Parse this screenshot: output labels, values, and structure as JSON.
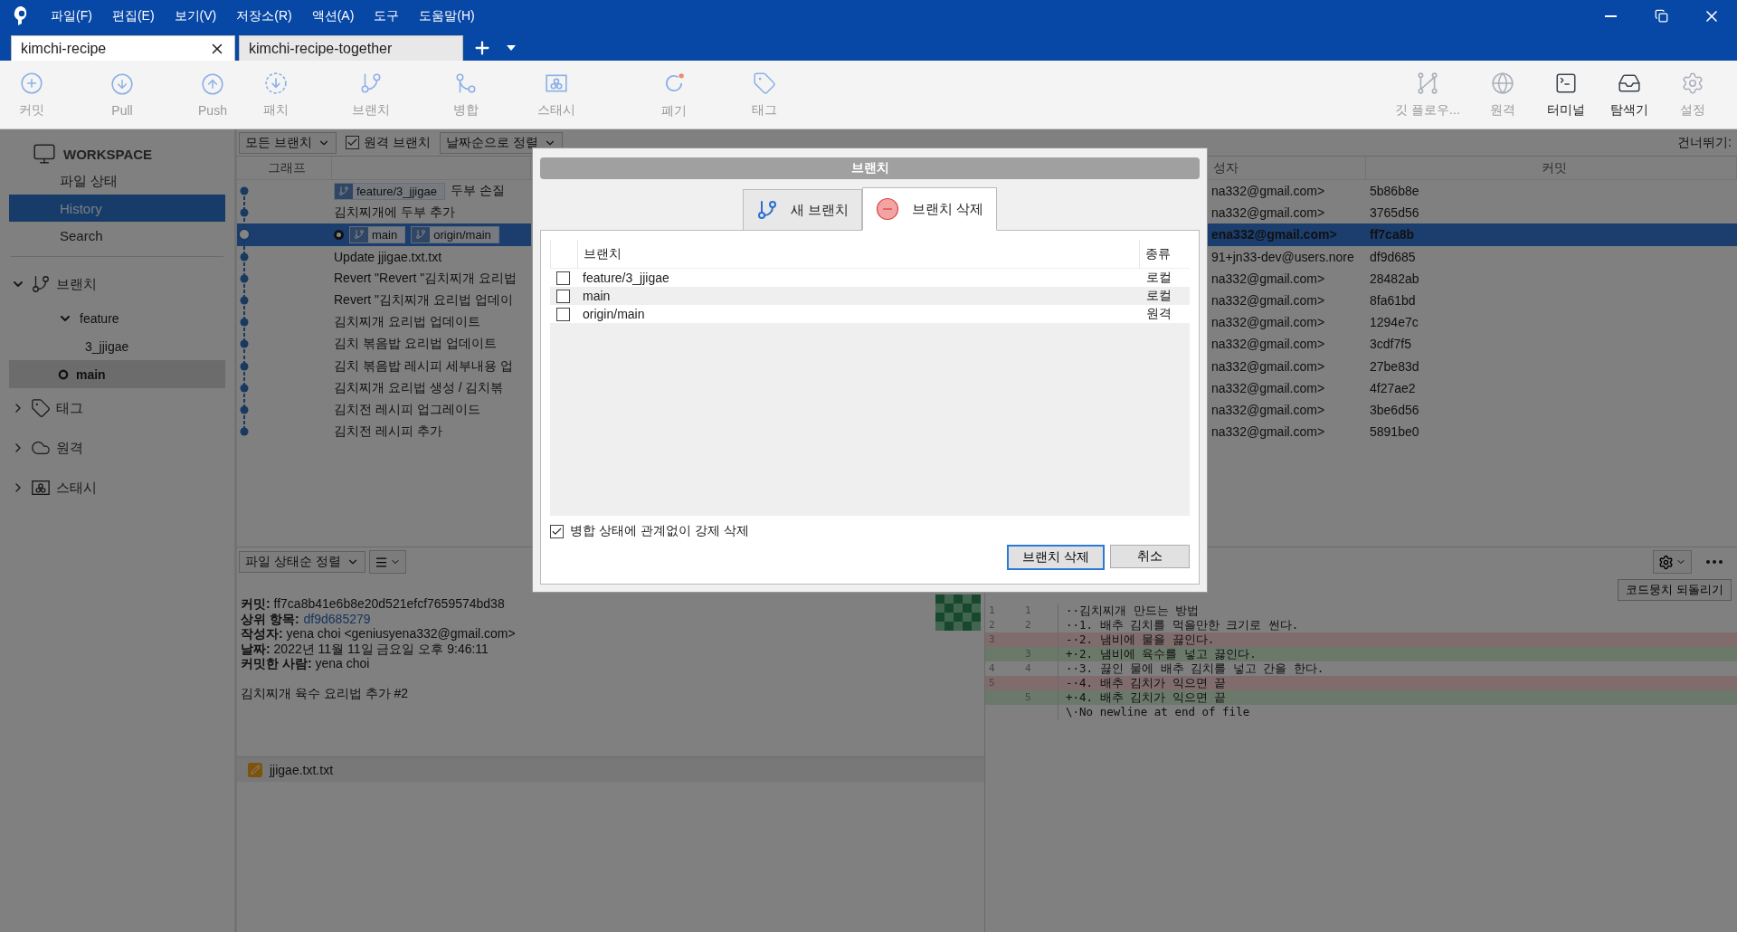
{
  "menu": [
    "파일(F)",
    "편집(E)",
    "보기(V)",
    "저장소(R)",
    "액션(A)",
    "도구",
    "도움말(H)"
  ],
  "repo_tabs": [
    {
      "label": "kimchi-recipe",
      "selected": true
    },
    {
      "label": "kimchi-recipe-together",
      "selected": false
    }
  ],
  "toolbar": {
    "left": [
      {
        "label": "커밋",
        "disabled": true
      },
      {
        "label": "Pull",
        "disabled": true
      },
      {
        "label": "Push",
        "disabled": true
      },
      {
        "label": "패치",
        "disabled": true
      },
      {
        "label": "브랜치",
        "disabled": true
      },
      {
        "label": "병합",
        "disabled": true
      },
      {
        "label": "스태시",
        "disabled": true
      },
      {
        "label": "폐기",
        "disabled": true
      },
      {
        "label": "태그",
        "disabled": true
      }
    ],
    "right": [
      {
        "label": "깃 플로우...",
        "disabled": true
      },
      {
        "label": "원격",
        "disabled": true
      },
      {
        "label": "터미널",
        "disabled": false
      },
      {
        "label": "탐색기",
        "disabled": false
      },
      {
        "label": "설정",
        "disabled": true
      }
    ]
  },
  "sidebar": {
    "workspace": {
      "title": "WORKSPACE",
      "items": [
        {
          "label": "파일 상태",
          "selected": false
        },
        {
          "label": "History",
          "selected": true
        },
        {
          "label": "Search",
          "selected": false
        }
      ]
    },
    "sections": [
      {
        "label": "브랜치",
        "expanded": true,
        "children": [
          {
            "label": "feature",
            "expanded": true,
            "children": [
              {
                "label": "3_jjigae",
                "current": false,
                "selected": false
              }
            ]
          },
          {
            "label": "main",
            "current": true,
            "selected": true
          }
        ]
      },
      {
        "label": "태그",
        "expanded": false
      },
      {
        "label": "원격",
        "expanded": false
      },
      {
        "label": "스태시",
        "expanded": false
      }
    ]
  },
  "filter_bar": {
    "branch_filter": "모든 브랜치",
    "remote_branches": {
      "label": "원격 브랜치",
      "checked": true
    },
    "sort": "날짜순으로 정렬",
    "jump_label": "건너뛰기:"
  },
  "commits": {
    "columns": [
      "그래프",
      "성자",
      "커밋"
    ],
    "rows": [
      {
        "refs": [
          "feature/3_jjigae"
        ],
        "description": "두부 손질",
        "author": "na332@gmail.com>",
        "commit": "5b86b8e",
        "selected": false,
        "head": false
      },
      {
        "description": "김치찌개에 두부 추가",
        "author": "na332@gmail.com>",
        "commit": "3765d56",
        "selected": false,
        "head": false
      },
      {
        "refs": [
          "main",
          "origin/main"
        ],
        "author": "ena332@gmail.com>",
        "commit": "ff7ca8b",
        "selected": true,
        "head": true
      },
      {
        "description": "Update jjigae.txt.txt",
        "author": "91+jn33-dev@users.nore",
        "commit": "df9d685",
        "selected": false,
        "head": false
      },
      {
        "description": "Revert \"Revert \"김치찌개 요리법",
        "author": "na332@gmail.com>",
        "commit": "28482ab",
        "selected": false,
        "head": false
      },
      {
        "description": "Revert \"김치찌개 요리법 업데이",
        "author": "na332@gmail.com>",
        "commit": "8fa61bd",
        "selected": false,
        "head": false
      },
      {
        "description": "김치찌개 요리법 업데이트",
        "author": "na332@gmail.com>",
        "commit": "1294e7c",
        "selected": false,
        "head": false
      },
      {
        "description": "김치 볶음밥 요리법 업데이트",
        "author": "na332@gmail.com>",
        "commit": "3cdf7f5",
        "selected": false,
        "head": false
      },
      {
        "description": "김치 볶음밥 레시피 세부내용 업",
        "author": "na332@gmail.com>",
        "commit": "27be83d",
        "selected": false,
        "head": false
      },
      {
        "description": "김치찌개 요리법 생성 / 김치볶",
        "author": "na332@gmail.com>",
        "commit": "4f27ae2",
        "selected": false,
        "head": false
      },
      {
        "description": "김치전 레시피 업그레이드",
        "author": "na332@gmail.com>",
        "commit": "3be6d56",
        "selected": false,
        "head": false
      },
      {
        "description": "김치전 레시피 추가",
        "author": "na332@gmail.com>",
        "commit": "5891be0",
        "selected": false,
        "head": false
      }
    ]
  },
  "details": {
    "sort": "파일 상태순 정렬",
    "lines": [
      {
        "kind": "text",
        "text": "**커밋:** ff7ca8b41e6b8e20d521efcf7659574bd38"
      },
      {
        "kind": "link",
        "label": "상위 항목:",
        "value": "df9d685279"
      },
      {
        "kind": "text",
        "text": "**작성자:** yena choi <geniusyena332@gmail.com>"
      },
      {
        "kind": "text",
        "text": "**날짜:** 2022년 11월 11일 금요일 오후 9:46:11"
      },
      {
        "kind": "text",
        "text": "**커밋한 사람:** yena choi"
      }
    ],
    "message": "김치찌개 육수 요리법 추가 #2",
    "files": [
      "jjigae.txt.txt"
    ]
  },
  "diff": {
    "revert_button": "코드뭉치 되돌리기",
    "lines": [
      {
        "kind": "context",
        "old": "1",
        "new": "1",
        "text": "··김치찌개 만드는 방법"
      },
      {
        "kind": "context",
        "old": "2",
        "new": "2",
        "text": "··1. 배추 김치를 먹을만한 크기로 썬다."
      },
      {
        "kind": "removed",
        "old": "3",
        "text": "-·2. 냄비에 물을 끓인다."
      },
      {
        "kind": "added",
        "new": "3",
        "text": "+·2. 냄비에 육수를 넣고 끓인다."
      },
      {
        "kind": "context",
        "old": "4",
        "new": "4",
        "text": "··3. 끓인 물에 배추 김치를 넣고 간을 한다."
      },
      {
        "kind": "removed",
        "old": "5",
        "text": "-·4. 배추 김치가 익으면 끝"
      },
      {
        "kind": "added",
        "new": "5",
        "text": "+·4. 배추 김치가 익으면 끝"
      },
      {
        "kind": "context",
        "text": "\\·No newline at end of file"
      }
    ]
  },
  "dialog": {
    "title": "브랜치",
    "tabs": [
      {
        "label": "새 브랜치",
        "selected": false
      },
      {
        "label": "브랜치 삭제",
        "selected": true
      }
    ],
    "columns": [
      "브랜치",
      "종류"
    ],
    "branches": [
      {
        "name": "feature/3_jjigae",
        "type": "로컬",
        "checked": false
      },
      {
        "name": "main",
        "type": "로컬",
        "checked": false
      },
      {
        "name": "origin/main",
        "type": "원격",
        "checked": false
      }
    ],
    "force": {
      "label": "병합 상태에 관계없이 강제 삭제",
      "checked": true
    },
    "buttons": [
      {
        "label": "브랜치 삭제",
        "default": true
      },
      {
        "label": "취소",
        "default": false
      }
    ]
  }
}
